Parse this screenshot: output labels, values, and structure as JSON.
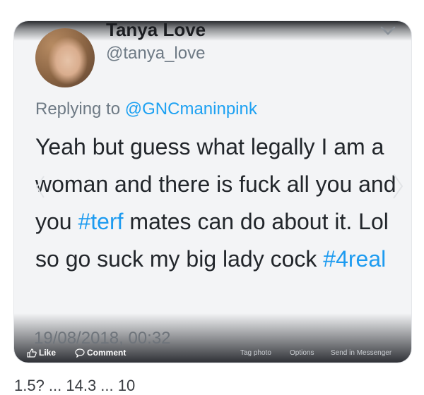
{
  "tweet": {
    "display_name": "Tanya Love",
    "handle": "@tanya_love",
    "replying_prefix": "Replying to ",
    "replying_to": "@GNCmaninpink",
    "text_1": "Yeah but guess what legally I am a woman and there is fuck all you and you ",
    "hashtag_1": "#terf",
    "text_2": " mates can do about it. Lol so go suck my big lady cock ",
    "hashtag_2": "#4real",
    "timestamp": "19/08/2018, 00:32",
    "cutoff_stats": "1.5? ... 14.3 ... 10"
  },
  "facebook_bar": {
    "like": "Like",
    "comment": "Comment",
    "tag_photo": "Tag photo",
    "options": "Options",
    "send": "Send in Messenger"
  },
  "icons": [
    "chevron-down-icon",
    "arrow-left-icon",
    "arrow-right-icon",
    "thumbs-up-icon",
    "comment-icon"
  ]
}
